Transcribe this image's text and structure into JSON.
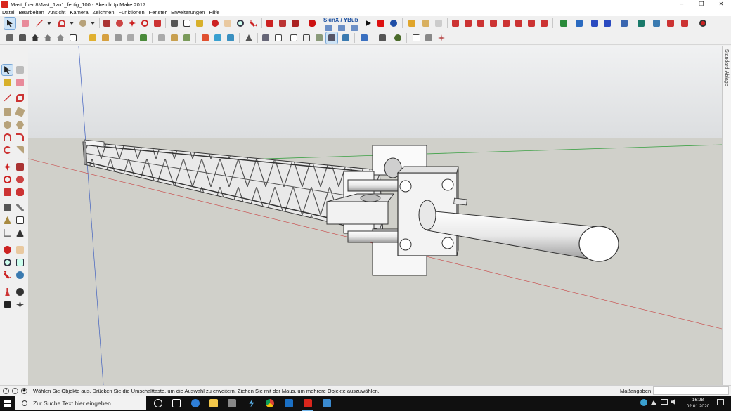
{
  "window": {
    "title": "Mast_fuer 8Mast_1zu1_fertig_100 - SketchUp Make 2017",
    "minimize": "–",
    "maximize": "❐",
    "close": "✕"
  },
  "menu": [
    "Datei",
    "Bearbeiten",
    "Ansicht",
    "Kamera",
    "Zeichnen",
    "Funktionen",
    "Fenster",
    "Erweiterungen",
    "Hilfe"
  ],
  "toolbar": {
    "skinx_label": "SkinX / YBub",
    "select_tool": "select-arrow-icon"
  },
  "tray": {
    "label": "Standard-Ablage"
  },
  "status": {
    "hint": "Wählen Sie Objekte aus. Drücken Sie die Umschalttaste, um die Auswahl zu erweitern. Ziehen Sie mit der Maus, um mehrere Objekte auszuwählen.",
    "measure_label": "Maßangaben",
    "measure_value": ""
  },
  "taskbar": {
    "search_placeholder": "Zur Suche Text hier eingeben",
    "time": "16:28",
    "date": "02.01.2020"
  },
  "colors": {
    "sky": "#dcdee0",
    "ground": "#d0d0ca",
    "axis_red": "#c84040",
    "axis_green": "#3aa043",
    "axis_blue": "#4060c0"
  }
}
